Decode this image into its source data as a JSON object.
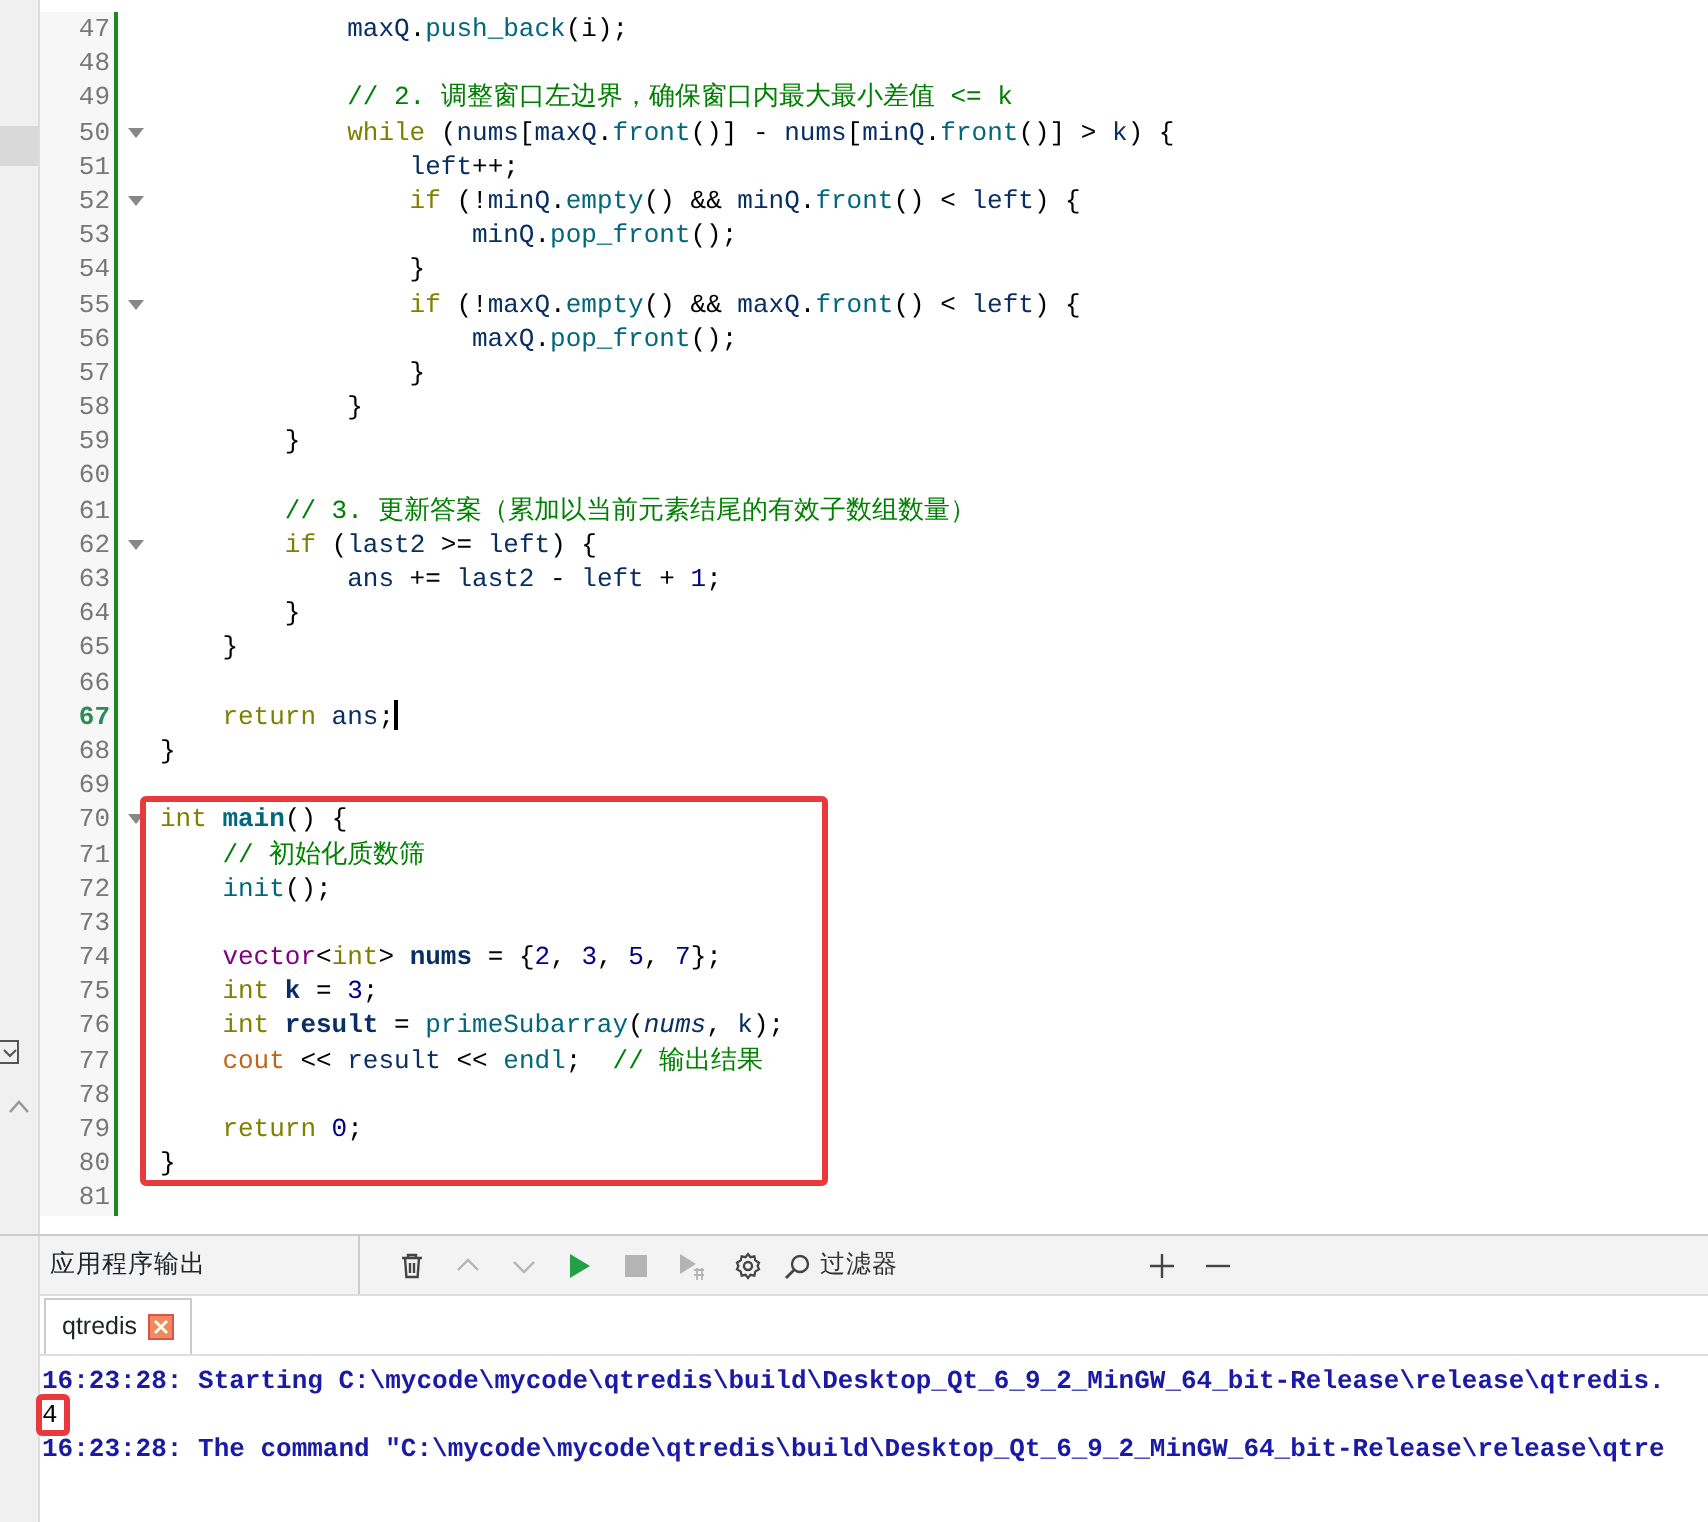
{
  "editor": {
    "lines": [
      {
        "number": "47",
        "fold": false,
        "current": false,
        "tokens": [
          {
            "text": "            maxQ",
            "kind": "variable"
          },
          {
            "text": ".",
            "kind": "plain"
          },
          {
            "text": "push_back",
            "kind": "function"
          },
          {
            "text": "(i);",
            "kind": "plain"
          }
        ]
      },
      {
        "number": "48",
        "fold": false,
        "current": false
      },
      {
        "number": "49",
        "fold": false,
        "current": false,
        "tokens": [
          {
            "text": "            // 2. 调整窗口左边界，确保窗口内最大最小差值 <= k",
            "kind": "comment"
          }
        ]
      },
      {
        "number": "50",
        "fold": true,
        "current": false,
        "tokens": [
          {
            "text": "            while",
            "kind": "keyword"
          },
          {
            "text": " (",
            "kind": "plain"
          },
          {
            "text": "nums",
            "kind": "variable"
          },
          {
            "text": "[",
            "kind": "plain"
          },
          {
            "text": "maxQ",
            "kind": "variable"
          },
          {
            "text": ".",
            "kind": "plain"
          },
          {
            "text": "front",
            "kind": "function"
          },
          {
            "text": "()] - ",
            "kind": "plain"
          },
          {
            "text": "nums",
            "kind": "variable"
          },
          {
            "text": "[",
            "kind": "plain"
          },
          {
            "text": "minQ",
            "kind": "variable"
          },
          {
            "text": ".",
            "kind": "plain"
          },
          {
            "text": "front",
            "kind": "function"
          },
          {
            "text": "()] > ",
            "kind": "plain"
          },
          {
            "text": "k",
            "kind": "variable"
          },
          {
            "text": ") {",
            "kind": "plain"
          }
        ]
      },
      {
        "number": "51",
        "fold": false,
        "current": false,
        "tokens": [
          {
            "text": "                left",
            "kind": "variable"
          },
          {
            "text": "++;",
            "kind": "plain"
          }
        ]
      },
      {
        "number": "52",
        "fold": true,
        "current": false,
        "tokens": [
          {
            "text": "                if",
            "kind": "keyword"
          },
          {
            "text": " (!",
            "kind": "plain"
          },
          {
            "text": "minQ",
            "kind": "variable"
          },
          {
            "text": ".",
            "kind": "plain"
          },
          {
            "text": "empty",
            "kind": "function"
          },
          {
            "text": "() && ",
            "kind": "plain"
          },
          {
            "text": "minQ",
            "kind": "variable"
          },
          {
            "text": ".",
            "kind": "plain"
          },
          {
            "text": "front",
            "kind": "function"
          },
          {
            "text": "() < ",
            "kind": "plain"
          },
          {
            "text": "left",
            "kind": "variable"
          },
          {
            "text": ") {",
            "kind": "plain"
          }
        ]
      },
      {
        "number": "53",
        "fold": false,
        "current": false,
        "tokens": [
          {
            "text": "                    minQ",
            "kind": "variable"
          },
          {
            "text": ".",
            "kind": "plain"
          },
          {
            "text": "pop_front",
            "kind": "function"
          },
          {
            "text": "();",
            "kind": "plain"
          }
        ]
      },
      {
        "number": "54",
        "fold": false,
        "current": false,
        "tokens": [
          {
            "text": "                }",
            "kind": "plain"
          }
        ]
      },
      {
        "number": "55",
        "fold": true,
        "current": false,
        "tokens": [
          {
            "text": "                if",
            "kind": "keyword"
          },
          {
            "text": " (!",
            "kind": "plain"
          },
          {
            "text": "maxQ",
            "kind": "variable"
          },
          {
            "text": ".",
            "kind": "plain"
          },
          {
            "text": "empty",
            "kind": "function"
          },
          {
            "text": "() && ",
            "kind": "plain"
          },
          {
            "text": "maxQ",
            "kind": "variable"
          },
          {
            "text": ".",
            "kind": "plain"
          },
          {
            "text": "front",
            "kind": "function"
          },
          {
            "text": "() < ",
            "kind": "plain"
          },
          {
            "text": "left",
            "kind": "variable"
          },
          {
            "text": ") {",
            "kind": "plain"
          }
        ]
      },
      {
        "number": "56",
        "fold": false,
        "current": false,
        "tokens": [
          {
            "text": "                    maxQ",
            "kind": "variable"
          },
          {
            "text": ".",
            "kind": "plain"
          },
          {
            "text": "pop_front",
            "kind": "function"
          },
          {
            "text": "();",
            "kind": "plain"
          }
        ]
      },
      {
        "number": "57",
        "fold": false,
        "current": false,
        "tokens": [
          {
            "text": "                }",
            "kind": "plain"
          }
        ]
      },
      {
        "number": "58",
        "fold": false,
        "current": false,
        "tokens": [
          {
            "text": "            }",
            "kind": "plain"
          }
        ]
      },
      {
        "number": "59",
        "fold": false,
        "current": false,
        "tokens": [
          {
            "text": "        }",
            "kind": "plain"
          }
        ]
      },
      {
        "number": "60",
        "fold": false,
        "current": false
      },
      {
        "number": "61",
        "fold": false,
        "current": false,
        "tokens": [
          {
            "text": "        // 3. 更新答案（累加以当前元素结尾的有效子数组数量）",
            "kind": "comment"
          }
        ]
      },
      {
        "number": "62",
        "fold": true,
        "current": false,
        "tokens": [
          {
            "text": "        if",
            "kind": "keyword"
          },
          {
            "text": " (",
            "kind": "plain"
          },
          {
            "text": "last2",
            "kind": "variable"
          },
          {
            "text": " >= ",
            "kind": "plain"
          },
          {
            "text": "left",
            "kind": "variable"
          },
          {
            "text": ") {",
            "kind": "plain"
          }
        ]
      },
      {
        "number": "63",
        "fold": false,
        "current": false,
        "tokens": [
          {
            "text": "            ans",
            "kind": "variable"
          },
          {
            "text": " += ",
            "kind": "plain"
          },
          {
            "text": "last2",
            "kind": "variable"
          },
          {
            "text": " - ",
            "kind": "plain"
          },
          {
            "text": "left",
            "kind": "variable"
          },
          {
            "text": " + ",
            "kind": "plain"
          },
          {
            "text": "1",
            "kind": "number"
          },
          {
            "text": ";",
            "kind": "plain"
          }
        ]
      },
      {
        "number": "64",
        "fold": false,
        "current": false,
        "tokens": [
          {
            "text": "        }",
            "kind": "plain"
          }
        ]
      },
      {
        "number": "65",
        "fold": false,
        "current": false,
        "tokens": [
          {
            "text": "    }",
            "kind": "plain"
          }
        ]
      },
      {
        "number": "66",
        "fold": false,
        "current": false
      },
      {
        "number": "67",
        "fold": false,
        "current": true,
        "tokens": [
          {
            "text": "    return",
            "kind": "keyword"
          },
          {
            "text": " ans",
            "kind": "variable"
          },
          {
            "text": ";",
            "kind": "plain"
          }
        ]
      },
      {
        "number": "68",
        "fold": false,
        "current": false,
        "tokens": [
          {
            "text": "}",
            "kind": "plain"
          }
        ]
      },
      {
        "number": "69",
        "fold": false,
        "current": false
      },
      {
        "number": "70",
        "fold": true,
        "current": false,
        "tokens": [
          {
            "text": "int",
            "kind": "keyword"
          },
          {
            "text": " main",
            "kind": "function-definition"
          },
          {
            "text": "() {",
            "kind": "plain"
          }
        ]
      },
      {
        "number": "71",
        "fold": false,
        "current": false,
        "tokens": [
          {
            "text": "    // 初始化质数筛",
            "kind": "comment"
          }
        ]
      },
      {
        "number": "72",
        "fold": false,
        "current": false,
        "tokens": [
          {
            "text": "    init",
            "kind": "function"
          },
          {
            "text": "();",
            "kind": "plain"
          }
        ]
      },
      {
        "number": "73",
        "fold": false,
        "current": false
      },
      {
        "number": "74",
        "fold": false,
        "current": false,
        "tokens": [
          {
            "text": "    vector",
            "kind": "type"
          },
          {
            "text": "<",
            "kind": "plain"
          },
          {
            "text": "int",
            "kind": "keyword"
          },
          {
            "text": "> ",
            "kind": "plain"
          },
          {
            "text": "nums",
            "kind": "declaration"
          },
          {
            "text": " = {",
            "kind": "plain"
          },
          {
            "text": "2",
            "kind": "number"
          },
          {
            "text": ", ",
            "kind": "plain"
          },
          {
            "text": "3",
            "kind": "number"
          },
          {
            "text": ", ",
            "kind": "plain"
          },
          {
            "text": "5",
            "kind": "number"
          },
          {
            "text": ", ",
            "kind": "plain"
          },
          {
            "text": "7",
            "kind": "number"
          },
          {
            "text": "};",
            "kind": "plain"
          }
        ]
      },
      {
        "number": "75",
        "fold": false,
        "current": false,
        "tokens": [
          {
            "text": "    int",
            "kind": "keyword"
          },
          {
            "text": " k",
            "kind": "declaration"
          },
          {
            "text": " = ",
            "kind": "plain"
          },
          {
            "text": "3",
            "kind": "number"
          },
          {
            "text": ";",
            "kind": "plain"
          }
        ]
      },
      {
        "number": "76",
        "fold": false,
        "current": false,
        "tokens": [
          {
            "text": "    int",
            "kind": "keyword"
          },
          {
            "text": " result",
            "kind": "declaration"
          },
          {
            "text": " = ",
            "kind": "plain"
          },
          {
            "text": "primeSubarray",
            "kind": "function"
          },
          {
            "text": "(",
            "kind": "plain"
          },
          {
            "text": "nums",
            "kind": "parameter"
          },
          {
            "text": ", ",
            "kind": "plain"
          },
          {
            "text": "k",
            "kind": "variable"
          },
          {
            "text": ");",
            "kind": "plain"
          }
        ]
      },
      {
        "number": "77",
        "fold": false,
        "current": false,
        "tokens": [
          {
            "text": "    cout",
            "kind": "stream"
          },
          {
            "text": " << ",
            "kind": "plain"
          },
          {
            "text": "result",
            "kind": "variable"
          },
          {
            "text": " << ",
            "kind": "plain"
          },
          {
            "text": "endl",
            "kind": "function"
          },
          {
            "text": ";  ",
            "kind": "plain"
          },
          {
            "text": "// 输出结果",
            "kind": "comment"
          }
        ]
      },
      {
        "number": "78",
        "fold": false,
        "current": false
      },
      {
        "number": "79",
        "fold": false,
        "current": false,
        "tokens": [
          {
            "text": "    return",
            "kind": "keyword"
          },
          {
            "text": " 0",
            "kind": "number"
          },
          {
            "text": ";",
            "kind": "plain"
          }
        ]
      },
      {
        "number": "80",
        "fold": false,
        "current": false,
        "tokens": [
          {
            "text": "}",
            "kind": "plain"
          }
        ]
      },
      {
        "number": "81",
        "fold": false,
        "current": false
      }
    ]
  },
  "output_panel": {
    "title": "应用程序输出",
    "tools": [
      {
        "kind": "clear",
        "disabled": false
      },
      {
        "kind": "up",
        "disabled": true
      },
      {
        "kind": "down",
        "disabled": true
      },
      {
        "kind": "run",
        "disabled": false
      },
      {
        "kind": "stop",
        "disabled": true
      },
      {
        "kind": "run-special",
        "disabled": true
      },
      {
        "kind": "settings",
        "disabled": false
      }
    ],
    "filter": {
      "placeholder": "过滤器"
    },
    "tabs": [
      {
        "label": "qtredis",
        "selected": true
      }
    ],
    "lines": [
      {
        "kind": "message",
        "text": "16:23:28: Starting C:\\mycode\\mycode\\qtredis\\build\\Desktop_Qt_6_9_2_MinGW_64_bit-Release\\release\\qtredis."
      },
      {
        "kind": "program",
        "text": "4"
      },
      {
        "kind": "message",
        "text": "16:23:28: The command \"C:\\mycode\\mycode\\qtredis\\build\\Desktop_Qt_6_9_2_MinGW_64_bit-Release\\release\\qtre"
      }
    ]
  }
}
